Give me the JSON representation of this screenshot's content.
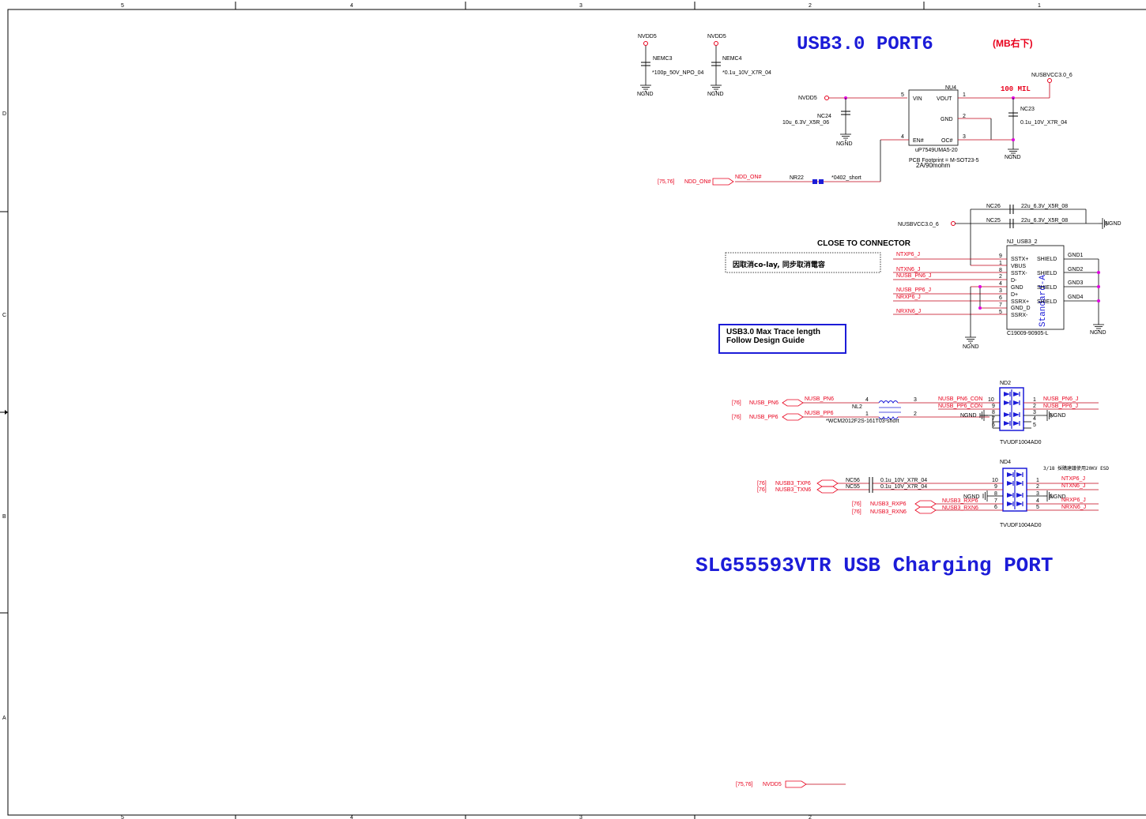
{
  "frame": {
    "top_zones": [
      "5",
      "4",
      "3",
      "2",
      "1"
    ],
    "bottom_zones": [
      "5",
      "4",
      "3",
      "2"
    ],
    "left_zones": [
      "D",
      "C",
      "B",
      "A"
    ]
  },
  "colors": {
    "wire": "#c00018",
    "net": "#e8001c",
    "title": "#1c1cd8",
    "junction": "#e000e0",
    "chip": "#1c1cd8"
  },
  "titles": {
    "main_title": "USB3.0  PORT6",
    "main_sub": "(MB右下)",
    "charging_title": "SLG55593VTR USB Charging PORT"
  },
  "caps_top": [
    {
      "rail": "NVDD5",
      "ref": "NEMC3",
      "value": "*100p_50V_NPO_04",
      "gnd": "NGND"
    },
    {
      "rail": "NVDD5",
      "ref": "NEMC4",
      "value": "*0.1u_10V_X7R_04",
      "gnd": "NGND"
    }
  ],
  "power_switch": {
    "ref": "NU4",
    "part": "uP7549UMA5-20",
    "footprint": "PCB Footprint = M-SOT23-5",
    "rating": "2A/90mohm",
    "pins": {
      "vin": "VIN",
      "vout": "VOUT",
      "gnd": "GND",
      "en": "EN#",
      "oc": "OC#"
    },
    "pin_numbers": [
      "5",
      "1",
      "2",
      "4",
      "3"
    ],
    "input_rail": "NVDD5",
    "input_cap": {
      "ref": "NC24",
      "value": "10u_6.3V_X5R_06",
      "gnd": "NGND"
    },
    "output_net": "NUSBVCC3.0_6",
    "trace_note": "100 MIL",
    "output_cap": {
      "ref": "NC23",
      "value": "0.1u_10V_X7R_04",
      "gnd": "NGND"
    },
    "enable_net": {
      "ref": "[75,76]",
      "name": "NDD_ON#",
      "wire_label": "NDD_ON#",
      "jumper_ref": "NR22",
      "jumper_value": "*0402_short"
    }
  },
  "connector": {
    "ref": "NJ_USB3_2",
    "part": "C19009-90905-L",
    "std": "Standard-A",
    "vbus_net": "NUSBVCC3.0_6",
    "bulk_caps": [
      {
        "ref": "NC26",
        "value": "22u_6.3V_X5R_08"
      },
      {
        "ref": "NC25",
        "value": "22u_6.3V_X5R_08"
      }
    ],
    "gnd_right": "NGND",
    "gnd_bottom": "NGND",
    "gnd_shield": "NGND",
    "note_close": "CLOSE TO CONNECTOR",
    "note_box": "因取消co-lay, 同步取消電容",
    "pins_left": [
      {
        "num": "9",
        "name": "SSTX+",
        "net": "NTXP6_J"
      },
      {
        "num": "1",
        "name": "VBUS",
        "net": ""
      },
      {
        "num": "8",
        "name": "SSTX-",
        "net": "NTXN6_J"
      },
      {
        "num": "2",
        "name": "D-",
        "net": "NUSB_PN6_J"
      },
      {
        "num": "4",
        "name": "GND",
        "net": ""
      },
      {
        "num": "3",
        "name": "D+",
        "net": "NUSB_PP6_J"
      },
      {
        "num": "6",
        "name": "SSRX+",
        "net": "NRXP6_J"
      },
      {
        "num": "7",
        "name": "GND_D",
        "net": ""
      },
      {
        "num": "5",
        "name": "SSRX-",
        "net": "NRXN6_J"
      }
    ],
    "shield_pins": [
      {
        "name": "SHIELD",
        "net": "GND1"
      },
      {
        "name": "SHIELD",
        "net": "GND2"
      },
      {
        "name": "SHIELD",
        "net": "GND3"
      },
      {
        "name": "SHIELD",
        "net": "GND4"
      }
    ]
  },
  "trace_note": "USB3.0 Max Trace length\nFollow Design Guide",
  "choke": {
    "ref": "NL2",
    "part": "*WCM2012F2S-161T03-short",
    "pins": [
      "4",
      "3",
      "1",
      "2"
    ],
    "inputs": [
      {
        "ref": "[76]",
        "name": "NUSB_PN6",
        "wire": "NUSB_PN6"
      },
      {
        "ref": "[76]",
        "name": "NUSB_PP6",
        "wire": "NUSB_PP6"
      }
    ],
    "outputs": [
      "NUSB_PN6_CON",
      "NUSB_PP6_CON"
    ]
  },
  "esd1": {
    "ref": "ND2",
    "part": "TVUDF1004AD0",
    "gnd": "NGND",
    "gnd_right": "NGND",
    "left_pins": [
      "10",
      "9",
      "8",
      "7",
      "6"
    ],
    "right_pins": [
      "1",
      "2",
      "3",
      "4",
      "5"
    ],
    "right_nets": [
      "NUSB_PN6_J",
      "NUSB_PP6_J"
    ]
  },
  "esd2": {
    "ref": "ND4",
    "part": "TVUDF1004AD0",
    "note": "3/18 採購建議使用20KV ESD",
    "gnd": "NGND",
    "gnd_right": "NGND",
    "left_pins": [
      "10",
      "9",
      "8",
      "7",
      "6"
    ],
    "right_pins": [
      "1",
      "2",
      "3",
      "4",
      "5"
    ],
    "right_nets": [
      "NTXP6_J",
      "NTXN6_J",
      "NRXP6_J",
      "NRXN6_J"
    ],
    "ac_caps": [
      {
        "ref": "NC56",
        "value": "0.1u_10V_X7R_04"
      },
      {
        "ref": "NC55",
        "value": "0.1u_10V_X7R_04"
      }
    ],
    "tx_inputs": [
      {
        "ref": "[76]",
        "name": "NUSB3_TXP6"
      },
      {
        "ref": "[76]",
        "name": "NUSB3_TXN6"
      }
    ],
    "rx_outputs": [
      {
        "ref": "[76]",
        "name": "NUSB3_RXP6",
        "wire": "NUSB3_RXP6"
      },
      {
        "ref": "[76]",
        "name": "NUSB3_RXN6",
        "wire": "NUSB3_RXN6"
      }
    ]
  },
  "bottom_port": {
    "ref": "[75,76]",
    "name": "NVDD5"
  }
}
